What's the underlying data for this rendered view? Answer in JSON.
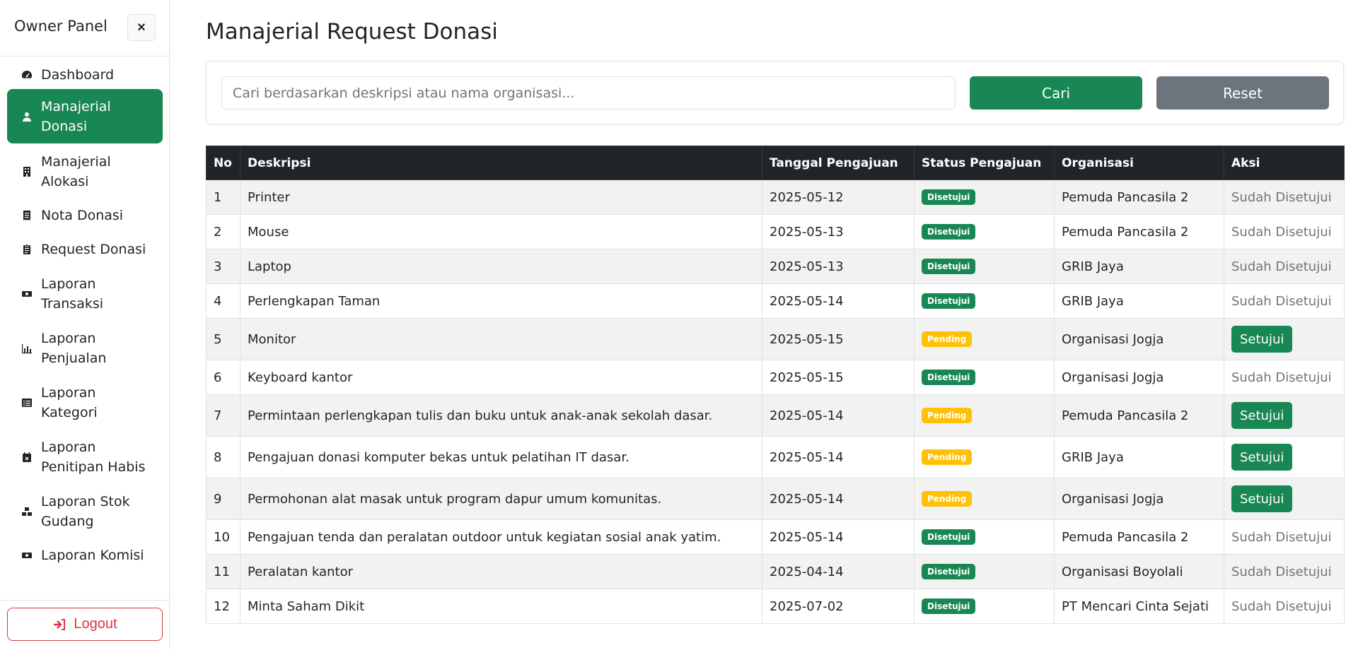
{
  "sidebar": {
    "title": "Owner Panel",
    "close_label": "×",
    "items": [
      {
        "label": "Dashboard",
        "icon": "speedometer-icon",
        "active": false
      },
      {
        "label": "Manajerial Donasi",
        "icon": "user-icon",
        "active": true
      },
      {
        "label": "Manajerial Alokasi",
        "icon": "building-icon",
        "active": false
      },
      {
        "label": "Nota Donasi",
        "icon": "receipt-icon",
        "active": false
      },
      {
        "label": "Request Donasi",
        "icon": "clipboard-icon",
        "active": false
      },
      {
        "label": "Laporan Transaksi",
        "icon": "money-icon",
        "active": false
      },
      {
        "label": "Laporan Penjualan",
        "icon": "bar-chart-icon",
        "active": false
      },
      {
        "label": "Laporan Kategori",
        "icon": "list-icon",
        "active": false
      },
      {
        "label": "Laporan Penitipan Habis",
        "icon": "calendar-x-icon",
        "active": false
      },
      {
        "label": "Laporan Stok Gudang",
        "icon": "boxes-icon",
        "active": false
      },
      {
        "label": "Laporan Komisi",
        "icon": "money-icon",
        "active": false
      }
    ],
    "logout_label": "Logout"
  },
  "main": {
    "title": "Manajerial Request Donasi",
    "search": {
      "placeholder": "Cari berdasarkan deskripsi atau nama organisasi...",
      "value": "",
      "submit_label": "Cari",
      "reset_label": "Reset"
    },
    "table": {
      "headers": [
        "No",
        "Deskripsi",
        "Tanggal Pengajuan",
        "Status Pengajuan",
        "Organisasi",
        "Aksi"
      ],
      "rows": [
        {
          "no": "1",
          "deskripsi": "Printer",
          "tanggal": "2025-05-12",
          "status": "Disetujui",
          "organisasi": "Pemuda Pancasila 2",
          "aksi": "Sudah Disetujui"
        },
        {
          "no": "2",
          "deskripsi": "Mouse",
          "tanggal": "2025-05-13",
          "status": "Disetujui",
          "organisasi": "Pemuda Pancasila 2",
          "aksi": "Sudah Disetujui"
        },
        {
          "no": "3",
          "deskripsi": "Laptop",
          "tanggal": "2025-05-13",
          "status": "Disetujui",
          "organisasi": "GRIB Jaya",
          "aksi": "Sudah Disetujui"
        },
        {
          "no": "4",
          "deskripsi": "Perlengkapan Taman",
          "tanggal": "2025-05-14",
          "status": "Disetujui",
          "organisasi": "GRIB Jaya",
          "aksi": "Sudah Disetujui"
        },
        {
          "no": "5",
          "deskripsi": "Monitor",
          "tanggal": "2025-05-15",
          "status": "Pending",
          "organisasi": "Organisasi Jogja",
          "aksi": "Setujui"
        },
        {
          "no": "6",
          "deskripsi": "Keyboard kantor",
          "tanggal": "2025-05-15",
          "status": "Disetujui",
          "organisasi": "Organisasi Jogja",
          "aksi": "Sudah Disetujui"
        },
        {
          "no": "7",
          "deskripsi": "Permintaan perlengkapan tulis dan buku untuk anak-anak sekolah dasar.",
          "tanggal": "2025-05-14",
          "status": "Pending",
          "organisasi": "Pemuda Pancasila 2",
          "aksi": "Setujui"
        },
        {
          "no": "8",
          "deskripsi": "Pengajuan donasi komputer bekas untuk pelatihan IT dasar.",
          "tanggal": "2025-05-14",
          "status": "Pending",
          "organisasi": "GRIB Jaya",
          "aksi": "Setujui"
        },
        {
          "no": "9",
          "deskripsi": "Permohonan alat masak untuk program dapur umum komunitas.",
          "tanggal": "2025-05-14",
          "status": "Pending",
          "organisasi": "Organisasi Jogja",
          "aksi": "Setujui"
        },
        {
          "no": "10",
          "deskripsi": "Pengajuan tenda dan peralatan outdoor untuk kegiatan sosial anak yatim.",
          "tanggal": "2025-05-14",
          "status": "Disetujui",
          "organisasi": "Pemuda Pancasila 2",
          "aksi": "Sudah Disetujui"
        },
        {
          "no": "11",
          "deskripsi": "Peralatan kantor",
          "tanggal": "2025-04-14",
          "status": "Disetujui",
          "organisasi": "Organisasi Boyolali",
          "aksi": "Sudah Disetujui"
        },
        {
          "no": "12",
          "deskripsi": "Minta Saham Dikit",
          "tanggal": "2025-07-02",
          "status": "Disetujui",
          "organisasi": "PT Mencari Cinta Sejati",
          "aksi": "Sudah Disetujui"
        }
      ]
    }
  },
  "colors": {
    "primary_green": "#198754",
    "secondary_gray": "#6c757d",
    "danger_red": "#dc3545",
    "pending_yellow": "#ffc107",
    "table_header": "#212529"
  }
}
